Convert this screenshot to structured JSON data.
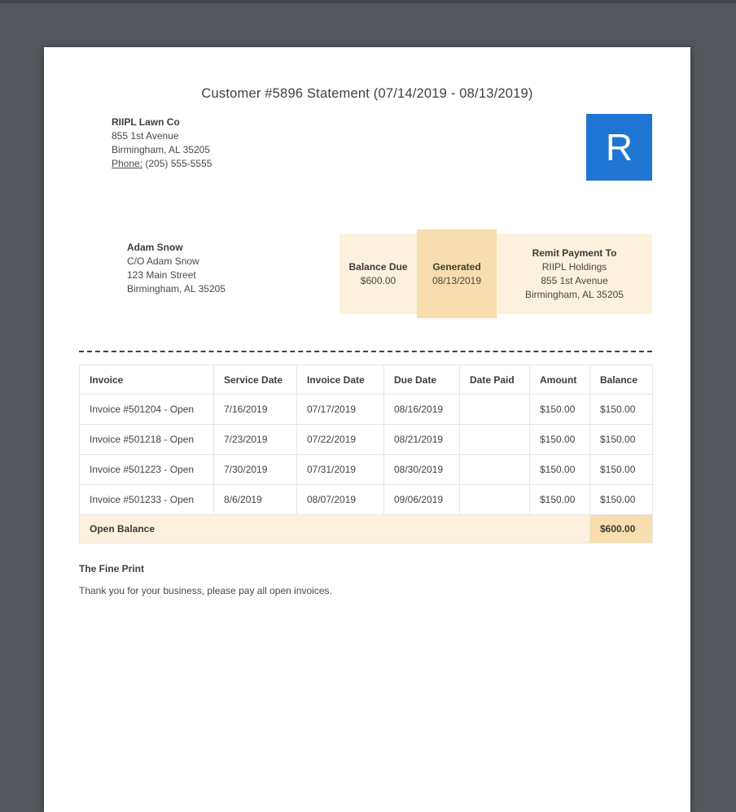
{
  "document": {
    "title": "Customer #5896 Statement (07/14/2019 - 08/13/2019)"
  },
  "company": {
    "name": "RIIPL Lawn Co",
    "address_line1": "855 1st Avenue",
    "address_line2": "Birmingham, AL 35205",
    "phone_label": "Phone:",
    "phone_value": "(205) 555-5555"
  },
  "logo": {
    "letter": "R",
    "color": "#1e76d2"
  },
  "customer": {
    "name": "Adam Snow",
    "care_of": "C/O Adam Snow",
    "address_line1": "123 Main Street",
    "address_line2": "Birmingham, AL 35205"
  },
  "summary": {
    "balance_due_label": "Balance Due",
    "balance_due_value": "$600.00",
    "generated_label": "Generated",
    "generated_value": "08/13/2019",
    "remit_label": "Remit Payment To",
    "remit_name": "RIIPL Holdings",
    "remit_address1": "855 1st Avenue",
    "remit_address2": "Birmingham, AL 35205"
  },
  "table": {
    "headers": [
      "Invoice",
      "Service Date",
      "Invoice Date",
      "Due Date",
      "Date Paid",
      "Amount",
      "Balance"
    ],
    "rows": [
      [
        "Invoice #501204 - Open",
        "7/16/2019",
        "07/17/2019",
        "08/16/2019",
        "",
        "$150.00",
        "$150.00"
      ],
      [
        "Invoice #501218 - Open",
        "7/23/2019",
        "07/22/2019",
        "08/21/2019",
        "",
        "$150.00",
        "$150.00"
      ],
      [
        "Invoice #501223 - Open",
        "7/30/2019",
        "07/31/2019",
        "08/30/2019",
        "",
        "$150.00",
        "$150.00"
      ],
      [
        "Invoice #501233 - Open",
        "8/6/2019",
        "08/07/2019",
        "09/06/2019",
        "",
        "$150.00",
        "$150.00"
      ]
    ],
    "footer_label": "Open Balance",
    "footer_value": "$600.00"
  },
  "fine_print": {
    "heading": "The Fine Print",
    "text": "Thank you for your business, please pay all open invoices."
  },
  "colors": {
    "background": "#53565b",
    "page": "#ffffff",
    "logo_blue": "#1e76d2",
    "cream": "#fcf1dd",
    "peach": "#f8deae",
    "dashed_line": "#36415f",
    "table_border": "#e6e6e6",
    "text": "#3f4347"
  }
}
